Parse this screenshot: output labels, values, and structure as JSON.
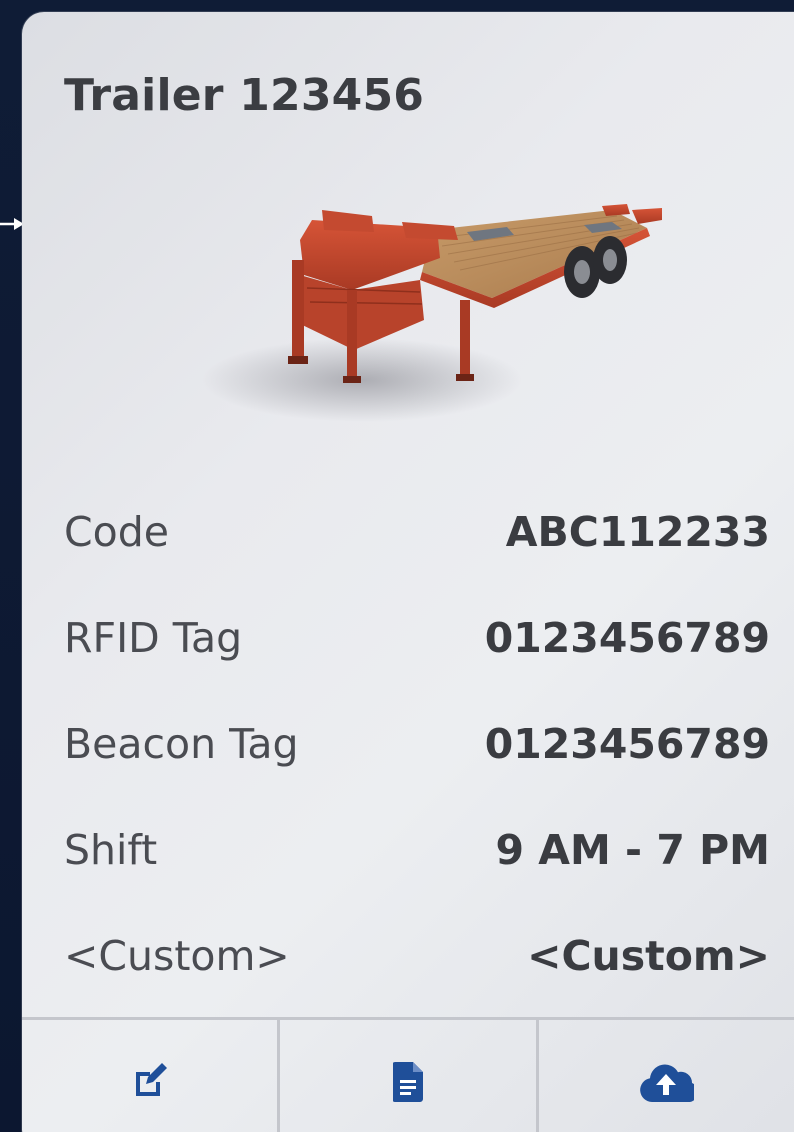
{
  "card": {
    "title": "Trailer 123456",
    "image_alt": "trailer-image"
  },
  "details": [
    {
      "label": "Code",
      "value": "ABC112233"
    },
    {
      "label": "RFID Tag",
      "value": "0123456789"
    },
    {
      "label": "Beacon Tag",
      "value": "0123456789"
    },
    {
      "label": "Shift",
      "value": "9 AM - 7 PM"
    },
    {
      "label": "<Custom>",
      "value": "<Custom>"
    }
  ],
  "toolbar": {
    "buttons": [
      {
        "icon": "edit-icon"
      },
      {
        "icon": "document-icon"
      },
      {
        "icon": "cloud-upload-icon"
      }
    ]
  },
  "colors": {
    "accent": "#1f4f99",
    "trailer_red": "#c8452e",
    "deck_wood": "#b88a5a",
    "background": "#0d1a33"
  }
}
